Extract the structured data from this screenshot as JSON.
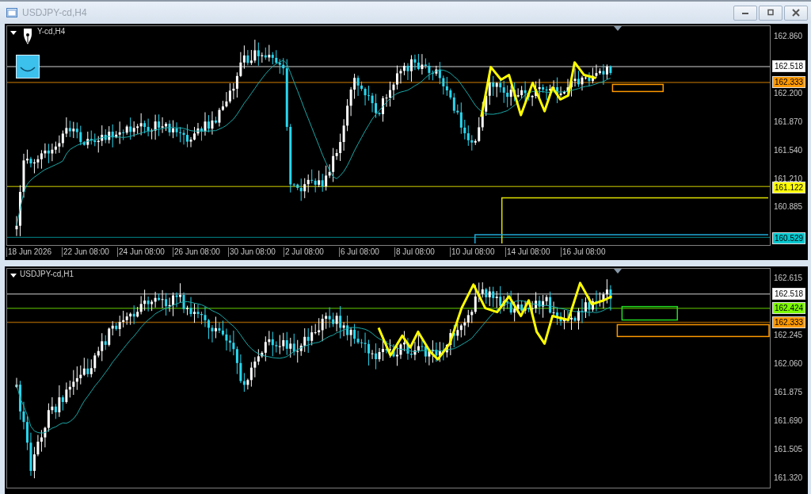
{
  "window": {
    "title": "USDJPY-cd,H4"
  },
  "charts": [
    {
      "label": "Y-cd,H4",
      "price_ticks": [
        "162.860",
        "162.200",
        "161.870",
        "161.540",
        "161.210",
        "160.885"
      ],
      "price_tags": [
        {
          "text": "162.518",
          "color": "#ffffff"
        },
        {
          "text": "162.333",
          "color": "#ff9900"
        },
        {
          "text": "161.122",
          "color": "#ffff00"
        },
        {
          "text": "160.529",
          "color": "#00c8d0"
        }
      ],
      "time_labels": [
        "18 Jun 2026",
        "22 Jun 08:00",
        "24 Jun 08:00",
        "26 Jun 08:00",
        "30 Jun 08:00",
        "2 Jul 08:00",
        "6 Jul 08:00",
        "8 Jul 08:00",
        "10 Jul 08:00",
        "14 Jul 08:00",
        "16 Jul 08:00"
      ]
    },
    {
      "label": "USDJPY-cd,H1",
      "price_ticks": [
        "162.615",
        "162.245",
        "162.060",
        "161.875",
        "161.690",
        "161.505",
        "161.320"
      ],
      "price_tags": [
        {
          "text": "162.518",
          "color": "#ffffff"
        },
        {
          "text": "162.424",
          "color": "#7cfc00"
        },
        {
          "text": "162.333",
          "color": "#ff9900"
        }
      ]
    }
  ]
}
